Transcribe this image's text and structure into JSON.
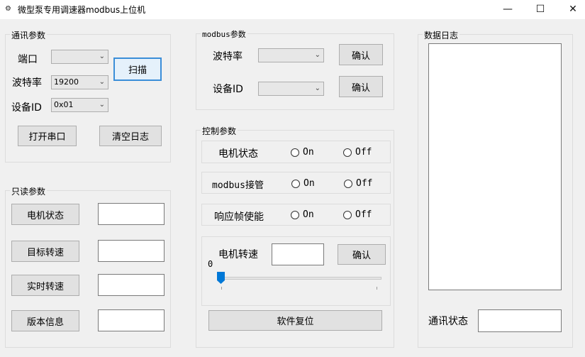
{
  "window": {
    "title": "微型泵专用调速器modbus上位机",
    "icon": "app-icon",
    "minimize": "—",
    "maximize": "☐",
    "close": "✕"
  },
  "comm": {
    "title": "通讯参数",
    "port_label": "端口",
    "port_value": "",
    "baud_label": "波特率",
    "baud_value": "19200",
    "device_id_label": "设备ID",
    "device_id_value": "0x01",
    "scan_button": "扫描",
    "open_port_button": "打开串口",
    "clear_log_button": "清空日志"
  },
  "readonly": {
    "title": "只读参数",
    "motor_status_button": "电机状态",
    "target_speed_button": "目标转速",
    "actual_speed_button": "实时转速",
    "version_button": "版本信息"
  },
  "modbus": {
    "title": "modbus参数",
    "baud_label": "波特率",
    "baud_value": "",
    "confirm_baud": "确认",
    "device_id_label": "设备ID",
    "device_id_value": "",
    "confirm_device": "确认"
  },
  "control": {
    "title": "控制参数",
    "motor_state_label": "电机状态",
    "modbus_takeover_label": "modbus接管",
    "response_frame_label": "响应帧使能",
    "on_label": "On",
    "off_label": "Off",
    "motor_speed_label": "电机转速",
    "speed_value": "",
    "confirm_speed": "确认",
    "slider_value": "0",
    "reset_button": "软件复位"
  },
  "log": {
    "title": "数据日志",
    "content": "",
    "comm_status_label": "通讯状态",
    "comm_status_value": ""
  }
}
